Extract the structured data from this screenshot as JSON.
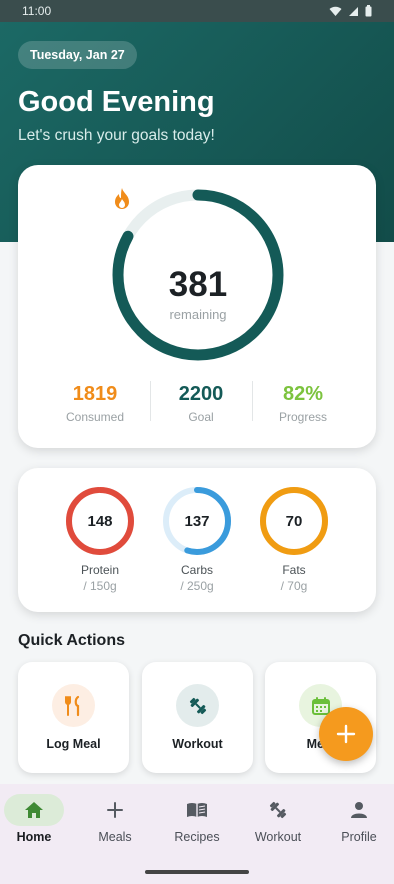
{
  "status_bar": {
    "time": "11:00"
  },
  "header": {
    "date": "Tuesday, Jan 27",
    "greeting": "Good Evening",
    "subtitle": "Let's crush your goals today!"
  },
  "calories": {
    "remaining_value": "381",
    "remaining_label": "remaining",
    "progress_fraction": 0.83,
    "stats": [
      {
        "value": "1819",
        "label": "Consumed",
        "color": "#f08c1a"
      },
      {
        "value": "2200",
        "label": "Goal",
        "color": "#145a57"
      },
      {
        "value": "82%",
        "label": "Progress",
        "color": "#7cc33e"
      }
    ]
  },
  "macros": [
    {
      "value": "148",
      "name": "Protein",
      "goal": "/ 150g",
      "fraction": 0.99,
      "color": "#e04b3c",
      "track": "#fbe1de"
    },
    {
      "value": "137",
      "name": "Carbs",
      "goal": "/ 250g",
      "fraction": 0.55,
      "color": "#3a9bdc",
      "track": "#dcedf9"
    },
    {
      "value": "70",
      "name": "Fats",
      "goal": "/ 70g",
      "fraction": 1.0,
      "color": "#f09c12",
      "track": "#fdebcf"
    }
  ],
  "quick_actions": {
    "title": "Quick Actions",
    "items": [
      {
        "label": "Log Meal",
        "icon": "fork-knife-icon",
        "bg": "#fdeee3",
        "color": "#f08c1a"
      },
      {
        "label": "Workout",
        "icon": "dumbbell-icon",
        "bg": "#e3ecec",
        "color": "#145a57"
      },
      {
        "label": "Meal",
        "icon": "calendar-icon",
        "bg": "#e8f4df",
        "color": "#6bbf3a"
      }
    ]
  },
  "fab": {
    "icon": "plus-icon",
    "color": "#f59a1e"
  },
  "bottom_nav": [
    {
      "label": "Home",
      "icon": "home-icon",
      "active": true
    },
    {
      "label": "Meals",
      "icon": "plus-icon",
      "active": false
    },
    {
      "label": "Recipes",
      "icon": "book-icon",
      "active": false
    },
    {
      "label": "Workout",
      "icon": "dumbbell-icon",
      "active": false
    },
    {
      "label": "Profile",
      "icon": "person-icon",
      "active": false
    }
  ]
}
